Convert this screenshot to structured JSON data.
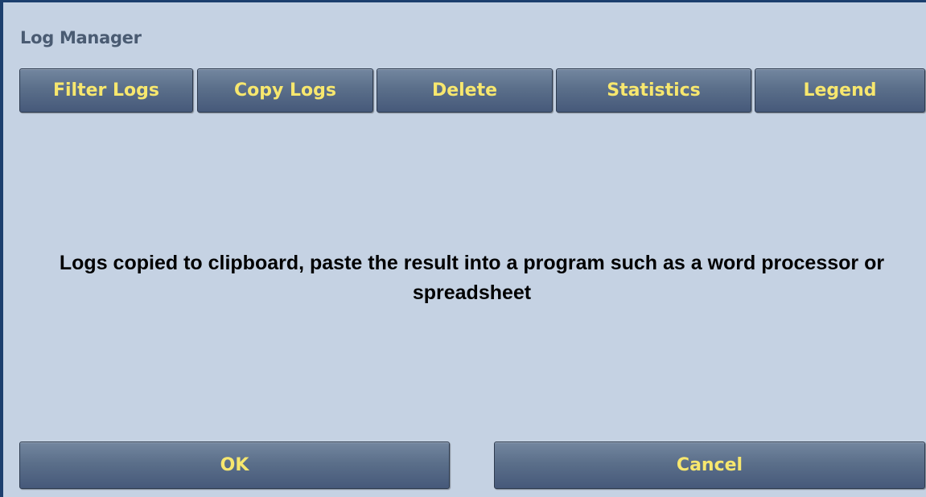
{
  "window": {
    "title": "Log Manager"
  },
  "toolbar": {
    "filter_logs": "Filter Logs",
    "copy_logs": "Copy Logs",
    "delete": "Delete",
    "statistics": "Statistics",
    "legend": "Legend"
  },
  "main": {
    "message": "Logs copied to clipboard, paste the result into a program such as a word processor or spreadsheet"
  },
  "footer": {
    "ok": "OK",
    "cancel": "Cancel"
  },
  "colors": {
    "background": "#c5d2e3",
    "border_accent": "#1c3f6e",
    "button_fill": "#5b6f8a",
    "button_text": "#f7e76e",
    "title_text": "#4a5b72"
  }
}
